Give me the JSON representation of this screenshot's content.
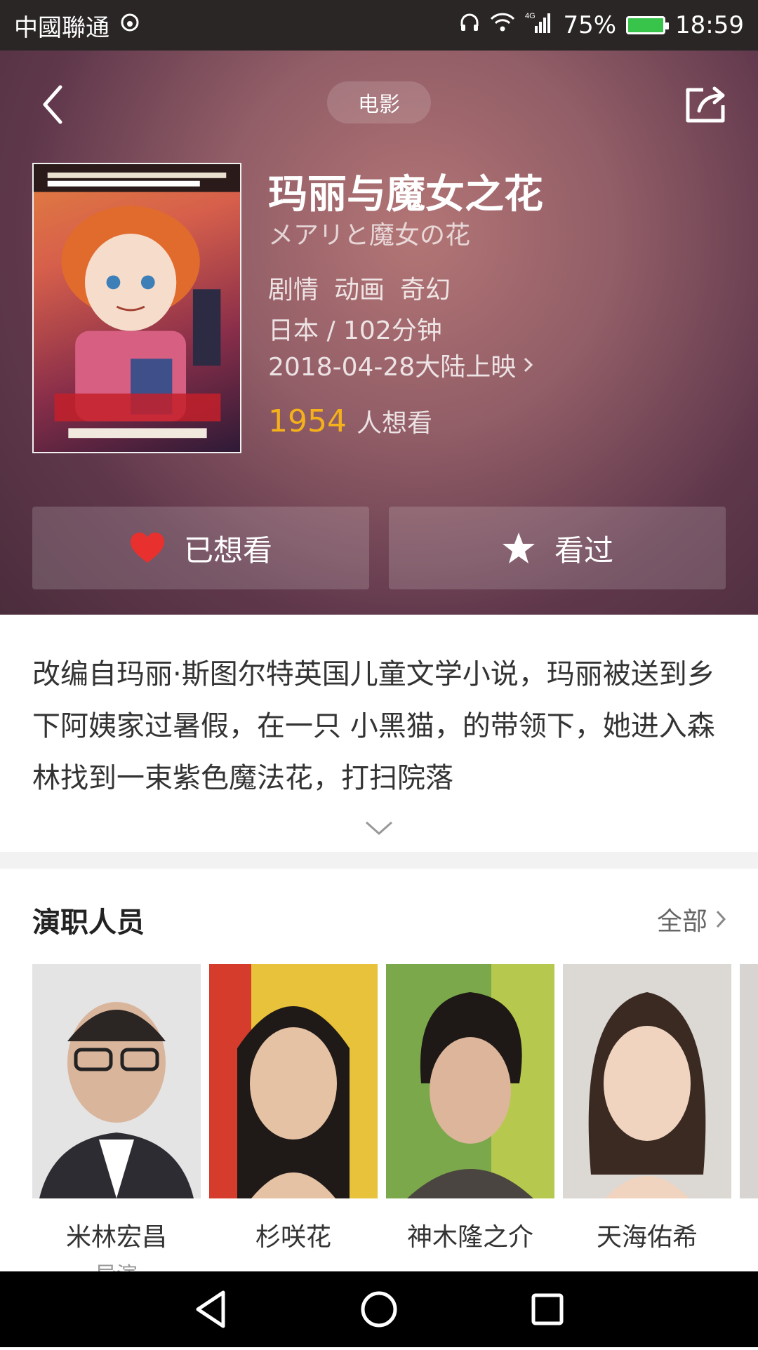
{
  "status_bar": {
    "carrier": "中國聯通",
    "battery_percent": "75%",
    "time": "18:59",
    "network": "4G"
  },
  "header": {
    "category_pill": "电影"
  },
  "movie": {
    "title": "玛丽与魔女之花",
    "original_title": "メアリと魔女の花",
    "genres": [
      "剧情",
      "动画",
      "奇幻"
    ],
    "country_duration": "日本 / 102分钟",
    "release": "2018-04-28大陆上映",
    "want_count": "1954",
    "want_label": "人想看",
    "poster_alt": "メアリと魔女の花"
  },
  "actions": {
    "wanted_label": "已想看",
    "seen_label": "看过"
  },
  "description": "改编自玛丽·斯图尔特英国儿童文学小说，玛丽被送到乡下阿姨家过暑假，在一只 小黑猫，的带领下，她进入森林找到一束紫色魔法花，打扫院落",
  "cast": {
    "section_title": "演职人员",
    "all_label": "全部",
    "members": [
      {
        "name": "米林宏昌",
        "role": "导演"
      },
      {
        "name": "杉咲花",
        "role": ""
      },
      {
        "name": "神木隆之介",
        "role": ""
      },
      {
        "name": "天海佑希",
        "role": ""
      }
    ]
  },
  "colors": {
    "accent_orange": "#f5b11a",
    "heart_red": "#e8302f"
  }
}
